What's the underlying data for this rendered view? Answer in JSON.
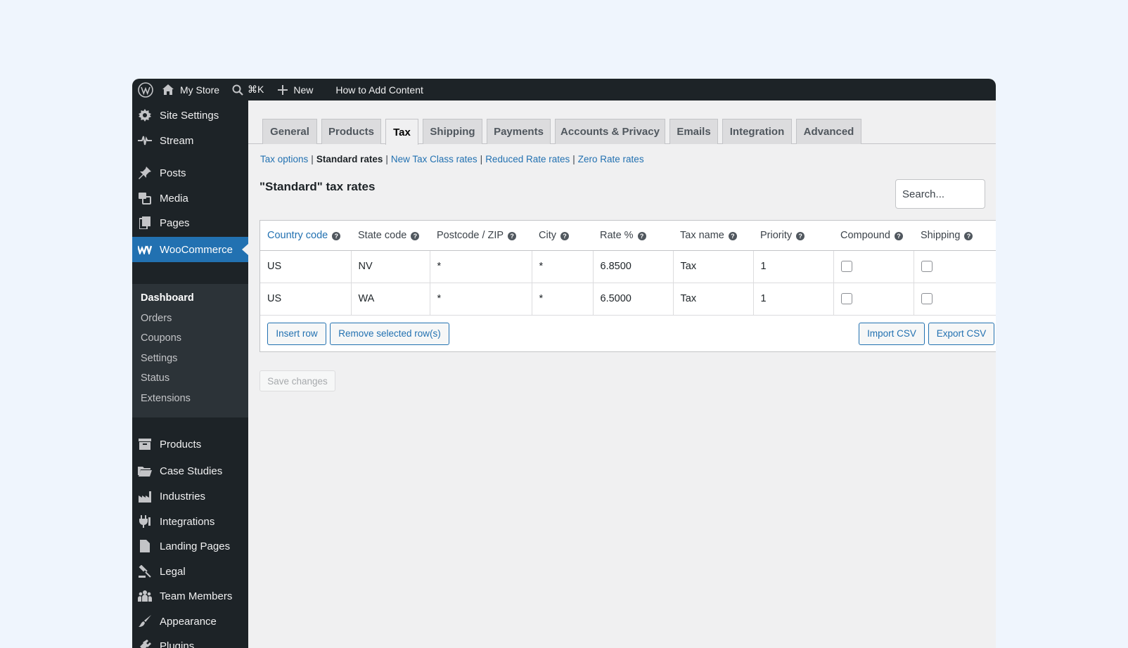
{
  "admin_bar": {
    "site_name": "My Store",
    "shortcut": "⌘K",
    "new_label": "New",
    "howto_label": "How to Add Content"
  },
  "sidebar": {
    "site_settings": "Site Settings",
    "stream": "Stream",
    "posts": "Posts",
    "media": "Media",
    "pages": "Pages",
    "woocommerce": "WooCommerce",
    "submenu": [
      "Dashboard",
      "Orders",
      "Coupons",
      "Settings",
      "Status",
      "Extensions"
    ],
    "products": "Products",
    "case_studies": "Case Studies",
    "industries": "Industries",
    "integrations": "Integrations",
    "landing_pages": "Landing Pages",
    "legal": "Legal",
    "team_members": "Team Members",
    "appearance": "Appearance",
    "plugins": "Plugins"
  },
  "tabs": [
    "General",
    "Products",
    "Tax",
    "Shipping",
    "Payments",
    "Accounts & Privacy",
    "Emails",
    "Integration",
    "Advanced"
  ],
  "active_tab": "Tax",
  "subnav": {
    "tax_options": "Tax options",
    "standard_rates": "Standard rates",
    "new_tax_class": "New Tax Class rates",
    "reduced_rate": "Reduced Rate rates",
    "zero_rate": "Zero Rate rates",
    "separator": "|"
  },
  "heading": "\"Standard\" tax rates",
  "search": {
    "placeholder": "Search..."
  },
  "table": {
    "headers": [
      "Country code",
      "State code",
      "Postcode / ZIP",
      "City",
      "Rate %",
      "Tax name",
      "Priority",
      "Compound",
      "Shipping"
    ],
    "rows": [
      {
        "country": "US",
        "state": "NV",
        "postcode": "*",
        "city": "*",
        "rate": "6.8500",
        "name": "Tax",
        "priority": "1",
        "compound": false,
        "shipping": false
      },
      {
        "country": "US",
        "state": "WA",
        "postcode": "*",
        "city": "*",
        "rate": "6.5000",
        "name": "Tax",
        "priority": "1",
        "compound": false,
        "shipping": false
      }
    ]
  },
  "buttons": {
    "insert_row": "Insert row",
    "remove_rows": "Remove selected row(s)",
    "import_csv": "Import CSV",
    "export_csv": "Export CSV",
    "save_changes": "Save changes"
  },
  "colors": {
    "admin_dark": "#1d2327",
    "accent": "#2271b1",
    "background": "#eff5fd"
  }
}
